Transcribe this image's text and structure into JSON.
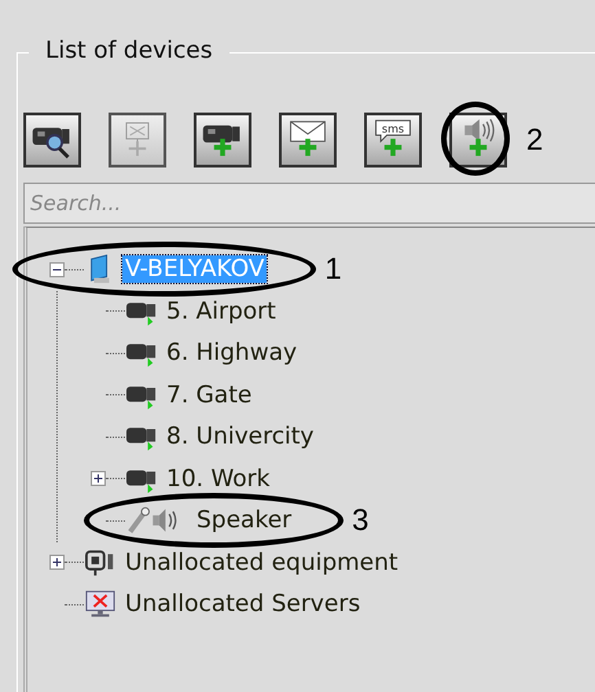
{
  "group": {
    "title": "List of devices"
  },
  "toolbar": {
    "buttons": [
      {
        "kind": "find-camera",
        "disabled": false
      },
      {
        "kind": "add-monitor",
        "disabled": true
      },
      {
        "kind": "add-camera",
        "disabled": false
      },
      {
        "kind": "add-email",
        "disabled": false
      },
      {
        "kind": "add-sms",
        "disabled": false,
        "label": "sms"
      },
      {
        "kind": "add-speaker",
        "disabled": false,
        "callout": "2"
      }
    ]
  },
  "search": {
    "placeholder": "Search..."
  },
  "tree": [
    {
      "kind": "computer",
      "label": "V-BELYAKOV",
      "selected": true,
      "expanded": true,
      "callout": "1",
      "children": [
        {
          "kind": "camera",
          "label": "5. Airport",
          "selected": false
        },
        {
          "kind": "camera",
          "label": "6. Highway",
          "selected": false
        },
        {
          "kind": "camera",
          "label": "7. Gate",
          "selected": false
        },
        {
          "kind": "camera",
          "label": "8. Univercity",
          "selected": false
        },
        {
          "kind": "camera",
          "label": "10. Work",
          "selected": false,
          "expanded": false
        },
        {
          "kind": "speaker",
          "label": "Speaker",
          "selected": false,
          "callout": "3"
        }
      ]
    },
    {
      "kind": "equipment",
      "label": "Unallocated equipment",
      "selected": false,
      "expanded": false
    },
    {
      "kind": "server",
      "label": "Unallocated Servers",
      "selected": false
    }
  ]
}
